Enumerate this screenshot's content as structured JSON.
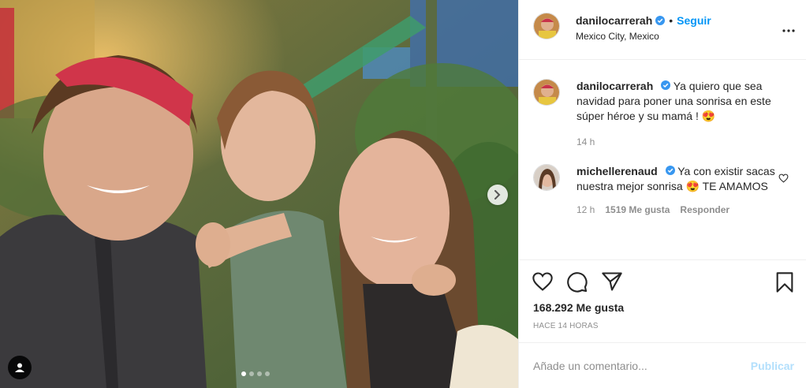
{
  "post": {
    "author": {
      "username": "danilocarrerah",
      "location": "Mexico City, Mexico",
      "follow_label": "Seguir",
      "separator": "•",
      "verified_icon": "verified-badge-icon"
    },
    "media": {
      "carousel_dots": 4,
      "active_index": 0,
      "next_icon": "chevron-right-icon",
      "tag_icon": "user-tag-icon"
    },
    "caption": {
      "username": "danilocarrerah",
      "text": "Ya quiero que sea navidad para poner una sonrisa en este súper héroe y su mamá ! 😍",
      "time": "14 h"
    },
    "comments": [
      {
        "username": "michellerenaud",
        "text": "Ya con existir sacas nuestra mejor sonrisa 😍 TE AMAMOS",
        "time": "12 h",
        "likes": "1519 Me gusta",
        "reply_label": "Responder"
      }
    ],
    "likes_count": "168.292 Me gusta",
    "time_ago": "HACE 14 HORAS",
    "add_comment": {
      "placeholder": "Añade un comentario...",
      "publish_label": "Publicar"
    }
  },
  "colors": {
    "accent": "#0095f6",
    "publish_disabled": "#b2dffc",
    "muted": "#8e8e8e",
    "text": "#262626",
    "border": "#efefef"
  }
}
